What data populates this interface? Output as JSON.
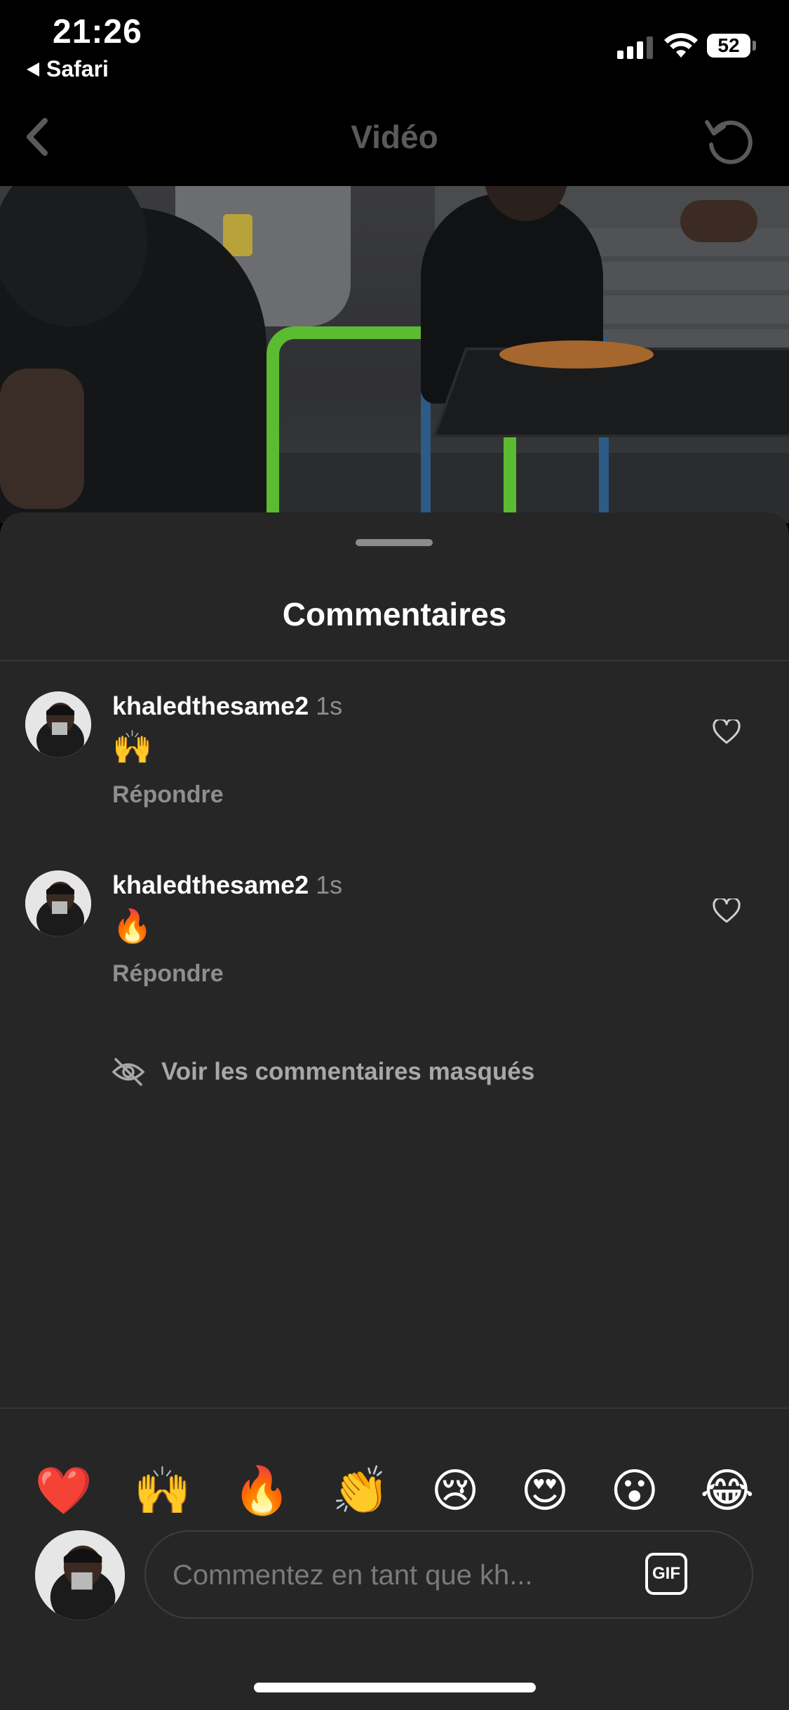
{
  "status_bar": {
    "time": "21:26",
    "back_app": "Safari",
    "battery": "52"
  },
  "nav": {
    "title": "Vidéo"
  },
  "sheet": {
    "title": "Commentaires",
    "comments": [
      {
        "username": "khaledthesame2",
        "time": "1s",
        "emoji": "🙌",
        "reply_label": "Répondre"
      },
      {
        "username": "khaledthesame2",
        "time": "1s",
        "emoji": "🔥",
        "reply_label": "Répondre"
      }
    ],
    "hidden_comments_label": "Voir les commentaires masqués",
    "quick_emojis": [
      "❤️",
      "🙌",
      "🔥",
      "👏",
      "😢",
      "😍",
      "😮",
      "😂"
    ],
    "input_placeholder": "Commentez en tant que kh...",
    "gif_label": "GIF"
  },
  "colors": {
    "sheet_bg": "#262626",
    "muted_text": "#8e8e8e"
  }
}
